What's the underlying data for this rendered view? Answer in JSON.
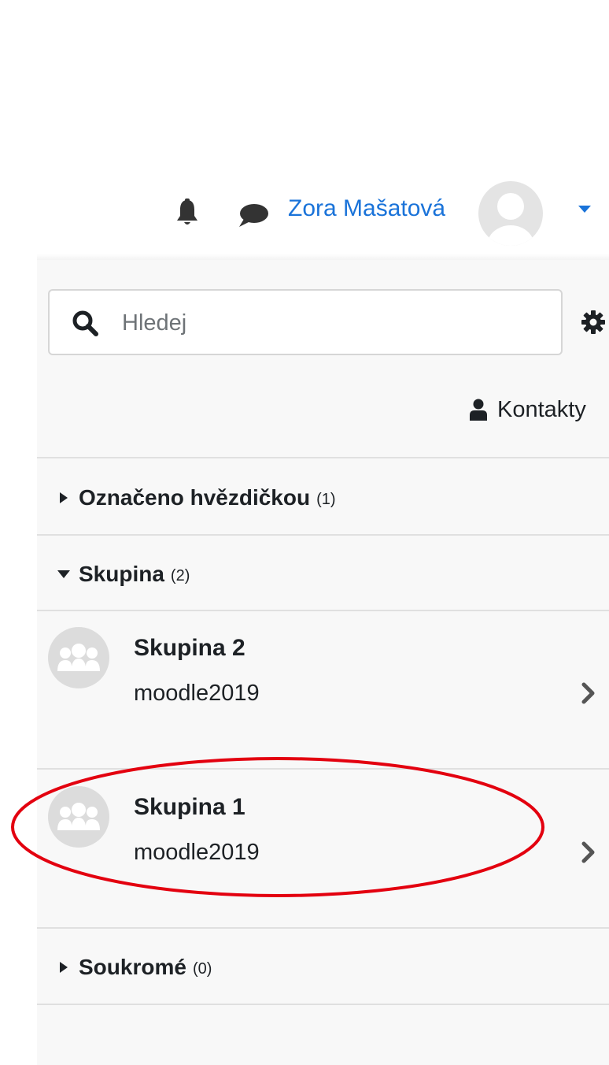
{
  "navbar": {
    "user_name": "Zora Mašatová",
    "icons": [
      "bell-icon",
      "chat-icon",
      "avatar",
      "caret-down-icon"
    ],
    "link_color": "#1a73d9"
  },
  "drawer": {
    "search": {
      "placeholder": "Hledej",
      "value": ""
    },
    "contacts_label": "Kontakty",
    "sections": {
      "starred": {
        "title": "Označeno hvězdičkou",
        "count": "(1)",
        "expanded": false
      },
      "group": {
        "title": "Skupina",
        "count": "(2)",
        "expanded": true,
        "items": [
          {
            "name": "Skupina 2",
            "subtitle": "moodle2019"
          },
          {
            "name": "Skupina 1",
            "subtitle": "moodle2019"
          }
        ]
      },
      "private": {
        "title": "Soukromé",
        "count": "(0)",
        "expanded": false
      }
    }
  },
  "annotation": {
    "shape": "ellipse",
    "color": "#e3000f",
    "highlights": "Skupina 1"
  }
}
